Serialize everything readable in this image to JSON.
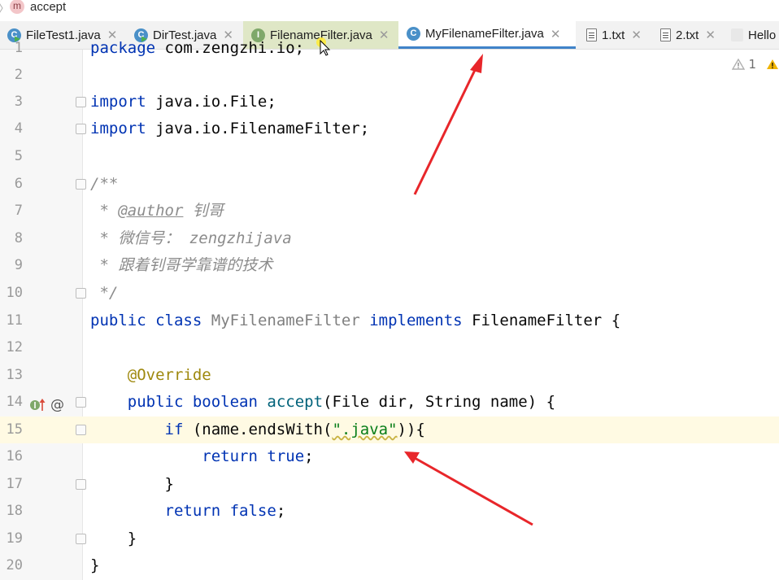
{
  "breadcrumb": {
    "icon_letter": "m",
    "label": "accept"
  },
  "tabs": [
    {
      "label": "FileTest1.java",
      "icon": "class-run"
    },
    {
      "label": "DirTest.java",
      "icon": "class-run"
    },
    {
      "label": "FilenameFilter.java",
      "icon": "interface"
    },
    {
      "label": "MyFilenameFilter.java",
      "icon": "class",
      "active": true
    },
    {
      "label": "1.txt",
      "icon": "text-file"
    },
    {
      "label": "2.txt",
      "icon": "text-file"
    },
    {
      "label": "Hello",
      "icon": "java-file"
    }
  ],
  "inspections": {
    "warning_count": "1"
  },
  "code_lines": [
    {
      "n": "1",
      "text": "package com.zengzhi.io;"
    },
    {
      "n": "2",
      "text": ""
    },
    {
      "n": "3",
      "text": "import java.io.File;"
    },
    {
      "n": "4",
      "text": "import java.io.FilenameFilter;"
    },
    {
      "n": "5",
      "text": ""
    },
    {
      "n": "6",
      "text": "/**"
    },
    {
      "n": "7",
      "text": " * @author 钊哥"
    },
    {
      "n": "8",
      "text": " * 微信号： zengzhijava"
    },
    {
      "n": "9",
      "text": " * 跟着钊哥学靠谱的技术"
    },
    {
      "n": "10",
      "text": " */"
    },
    {
      "n": "11",
      "text": "public class MyFilenameFilter implements FilenameFilter {"
    },
    {
      "n": "12",
      "text": ""
    },
    {
      "n": "13",
      "text": "    @Override"
    },
    {
      "n": "14",
      "text": "    public boolean accept(File dir, String name) {"
    },
    {
      "n": "15",
      "text": "        if (name.endsWith(\".java\")){"
    },
    {
      "n": "16",
      "text": "            return true;"
    },
    {
      "n": "17",
      "text": "        }"
    },
    {
      "n": "18",
      "text": "        return false;"
    },
    {
      "n": "19",
      "text": "    }"
    },
    {
      "n": "20",
      "text": "}"
    }
  ],
  "tokens": {
    "package_kw": "package",
    "package_name": "com.zengzhi.io;",
    "import_kw": "import",
    "import1": "java.io.File;",
    "import2": "java.io.FilenameFilter;",
    "doc_open": "/**",
    "doc_star": " *",
    "author_tag": "@author",
    "author_name": "钊哥",
    "wechat_label": "微信号：",
    "wechat_id": "zengzhijava",
    "motto": "跟着钊哥学靠谱的技术",
    "doc_close": " */",
    "public_kw": "public",
    "class_kw": "class",
    "class_name": "MyFilenameFilter",
    "implements_kw": "implements",
    "iface_name": "FilenameFilter",
    "open_brace": "{",
    "override": "@Override",
    "boolean_kw": "boolean",
    "method_name": "accept",
    "params_1": "(File dir, String name) {",
    "if_kw": "if",
    "cond_1": " (name.endsWith(",
    "java_str": "\".java\"",
    "cond_2": ")){",
    "return_kw": "return",
    "true_kw": "true",
    "false_kw": "false",
    "semicolon": ";",
    "close_brace": "}"
  },
  "colors": {
    "keyword": "#0033b3",
    "comment": "#8c8c8c",
    "annotation": "#9e880d",
    "string": "#067d17",
    "active_tab_underline": "#4083c9",
    "arrow": "#e8262a"
  }
}
